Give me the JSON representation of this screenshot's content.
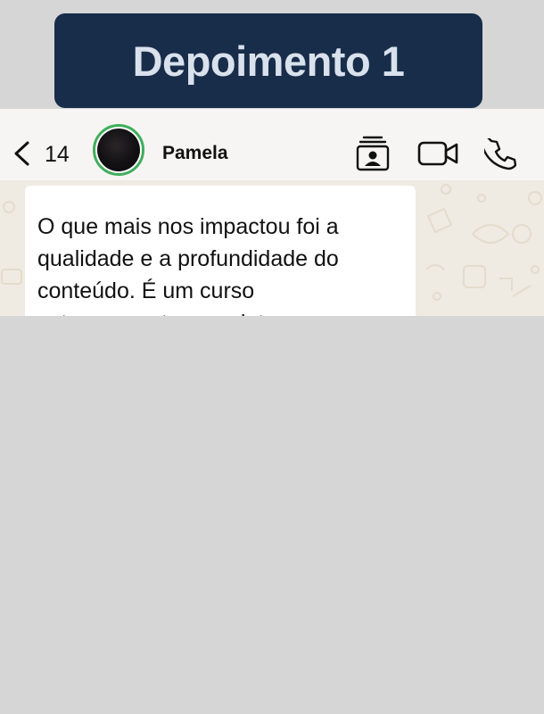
{
  "banner": {
    "title": "Depoimento 1"
  },
  "header": {
    "back_count": "14",
    "contact_name": "Pamela",
    "icons": [
      "chevron-left-icon",
      "contact-card-icon",
      "video-camera-icon",
      "phone-icon"
    ]
  },
  "message": {
    "lines": [
      "O que mais nos impactou foi a",
      "qualidade e a profundidade do",
      "conteúdo. É um curso",
      "extremamente completo"
    ]
  },
  "colors": {
    "banner_bg": "#172d4a",
    "banner_text": "#d9e1ec",
    "chat_bg": "#efeae2",
    "avatar_ring": "#3fae5b",
    "page_bg": "#d6d6d6"
  }
}
